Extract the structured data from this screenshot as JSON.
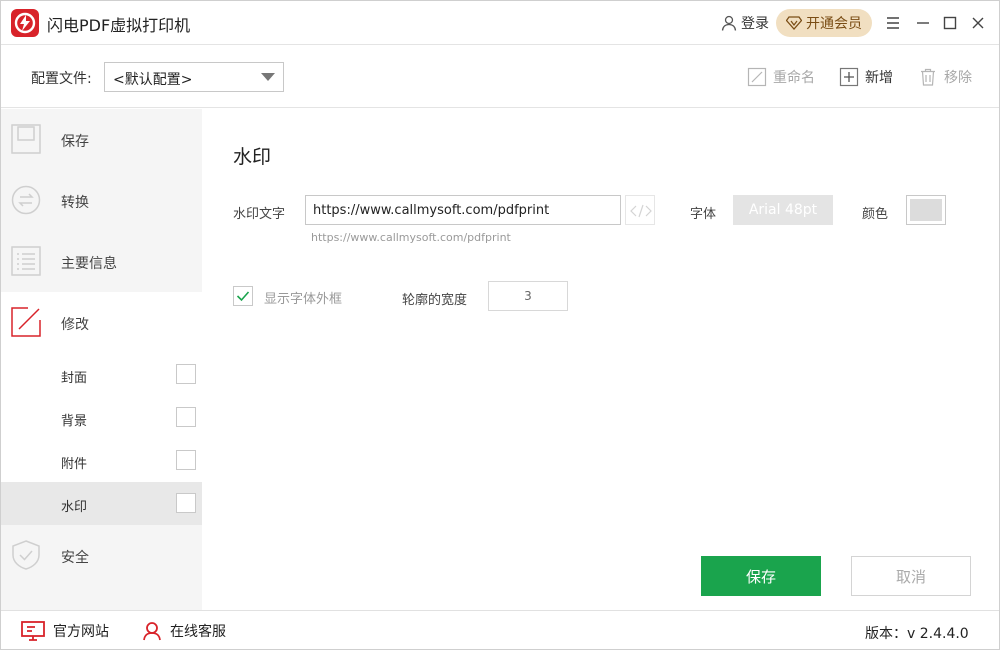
{
  "app": {
    "title": "闪电PDF虚拟打印机"
  },
  "titlebar": {
    "login_label": "登录",
    "vip_label": "开通会员"
  },
  "config": {
    "label": "配置文件:",
    "selected": "<默认配置>",
    "rename_label": "重命名",
    "add_label": "新增",
    "remove_label": "移除"
  },
  "sidebar": {
    "items": [
      {
        "label": "保存",
        "icon": "save-icon"
      },
      {
        "label": "转换",
        "icon": "convert-icon"
      },
      {
        "label": "主要信息",
        "icon": "list-icon"
      },
      {
        "label": "修改",
        "icon": "edit-icon"
      },
      {
        "label": "安全",
        "icon": "shield-icon"
      }
    ],
    "sub_items": [
      {
        "label": "封面",
        "checked": false
      },
      {
        "label": "背景",
        "checked": false
      },
      {
        "label": "附件",
        "checked": false
      },
      {
        "label": "水印",
        "checked": false
      }
    ]
  },
  "watermark": {
    "section_title": "水印",
    "text_label": "水印文字",
    "text_value": "https://www.callmysoft.com/pdfprint",
    "hint": "https://www.callmysoft.com/pdfprint",
    "font_label": "字体",
    "font_value": "Arial 48pt",
    "color_label": "颜色",
    "color_value": "#dcdcdc",
    "outline_label": "显示字体外框",
    "outline_checked": true,
    "outline_width_label": "轮廓的宽度",
    "outline_width_value": "3"
  },
  "actions": {
    "save_label": "保存",
    "cancel_label": "取消"
  },
  "footer": {
    "website_label": "官方网站",
    "support_label": "在线客服",
    "version_label": "版本：v 2.4.4.0"
  },
  "colors": {
    "brand_red": "#d8232a",
    "save_green": "#1aa44d",
    "vip_gold": "#f1dfc1"
  }
}
